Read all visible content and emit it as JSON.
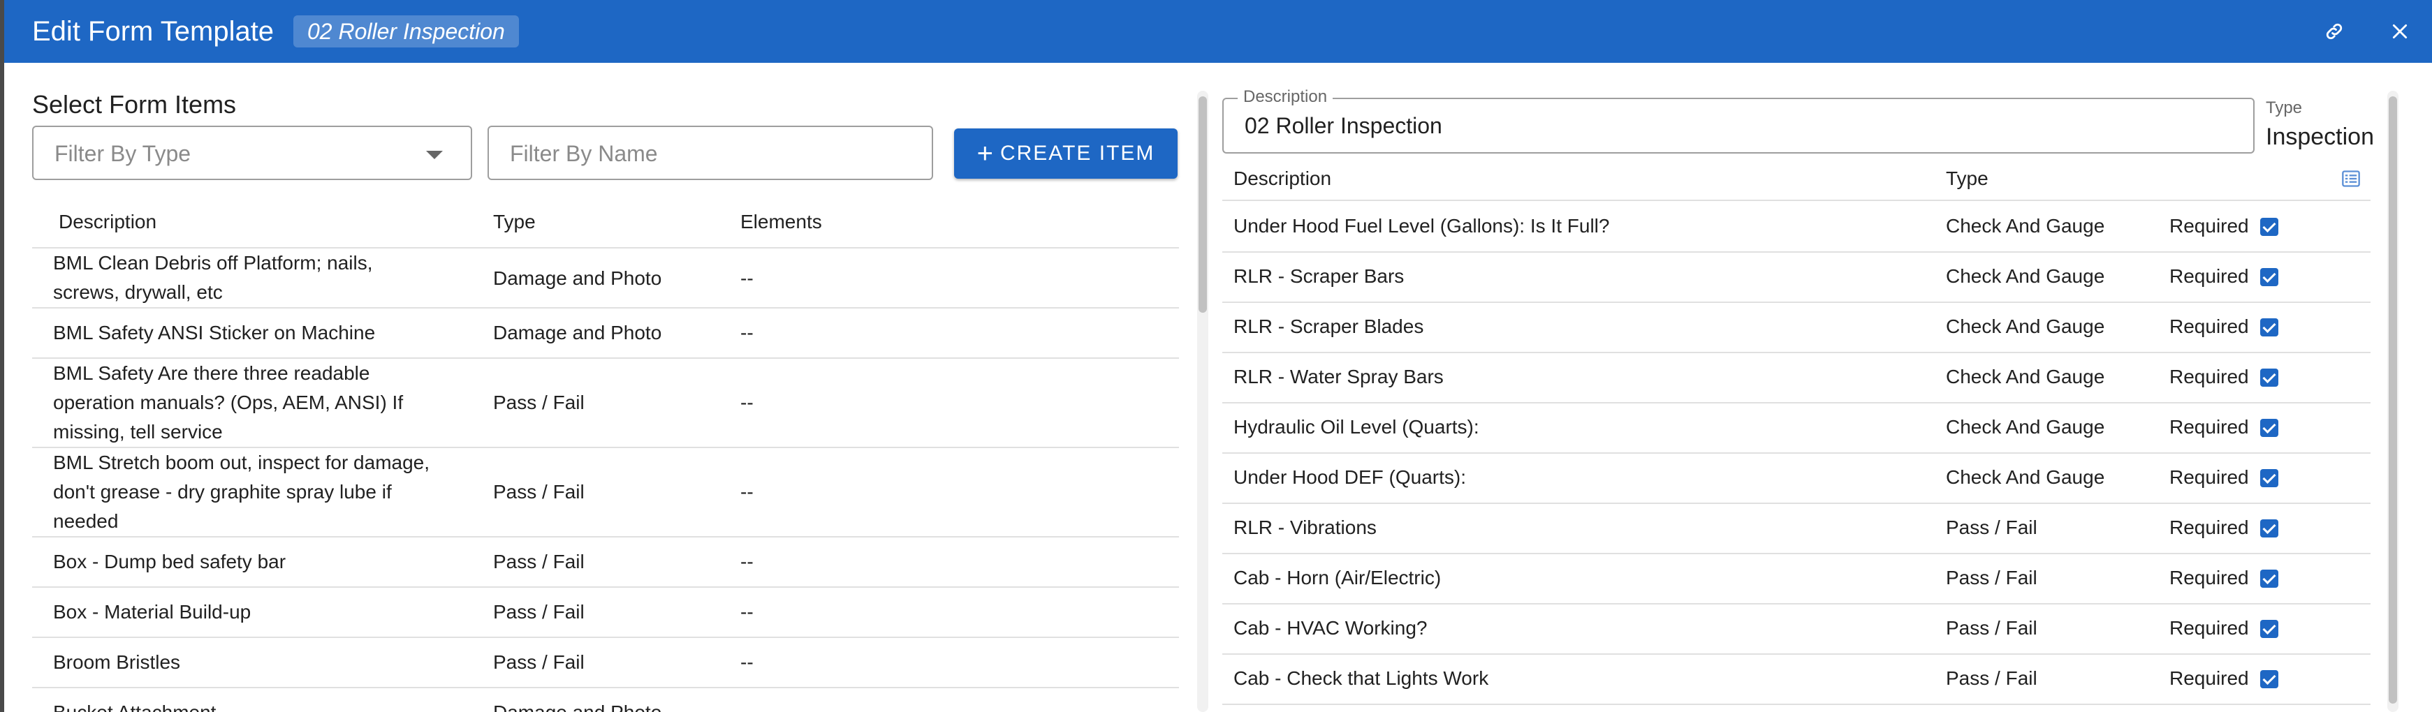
{
  "dialog": {
    "title": "Edit Form Template",
    "template_chip": "02 Roller Inspection"
  },
  "left": {
    "heading": "Select Form Items",
    "filter_type_placeholder": "Filter By Type",
    "filter_name_placeholder": "Filter By Name",
    "create_label": "CREATE ITEM",
    "columns": [
      "Description",
      "Type",
      "Elements"
    ],
    "rows": [
      {
        "description": "BML Clean Debris off Platform; nails, screws, drywall, etc",
        "type": "Damage and Photo",
        "elements": "--"
      },
      {
        "description": "BML Safety ANSI Sticker on Machine",
        "type": "Damage and Photo",
        "elements": "--"
      },
      {
        "description": "BML Safety Are there three readable operation manuals? (Ops, AEM, ANSI) If missing, tell service",
        "type": "Pass / Fail",
        "elements": "--"
      },
      {
        "description": "BML Stretch boom out, inspect for damage, don't grease - dry graphite spray lube if needed",
        "type": "Pass / Fail",
        "elements": "--"
      },
      {
        "description": "Box - Dump bed safety bar",
        "type": "Pass / Fail",
        "elements": "--"
      },
      {
        "description": "Box - Material Build-up",
        "type": "Pass / Fail",
        "elements": "--"
      },
      {
        "description": "Broom Bristles",
        "type": "Pass / Fail",
        "elements": "--"
      },
      {
        "description": "Bucket Attachment",
        "type": "Damage and Photo",
        "elements": ""
      }
    ]
  },
  "right": {
    "description_label": "Description",
    "description_value": "02 Roller Inspection",
    "type_label": "Type",
    "type_value": "Inspection",
    "columns": [
      "Description",
      "Type"
    ],
    "required_label": "Required",
    "rows": [
      {
        "description": "Under Hood Fuel Level (Gallons): Is It Full?",
        "type": "Check And Gauge"
      },
      {
        "description": "RLR - Scraper Bars",
        "type": "Check And Gauge"
      },
      {
        "description": "RLR - Scraper Blades",
        "type": "Check And Gauge"
      },
      {
        "description": "RLR - Water Spray Bars",
        "type": "Check And Gauge"
      },
      {
        "description": "Hydraulic Oil Level (Quarts):",
        "type": "Check And Gauge"
      },
      {
        "description": "Under Hood DEF (Quarts):",
        "type": "Check And Gauge"
      },
      {
        "description": "RLR - Vibrations",
        "type": "Pass / Fail"
      },
      {
        "description": "Cab - Horn (Air/Electric)",
        "type": "Pass / Fail"
      },
      {
        "description": "Cab - HVAC Working?",
        "type": "Pass / Fail"
      },
      {
        "description": "Cab - Check that Lights Work",
        "type": "Pass / Fail"
      }
    ]
  },
  "icons": {
    "link": "link-icon",
    "close": "close-icon",
    "dropdown": "chevron-down-icon",
    "list": "list-view-icon",
    "checkbox": "checkbox-checked-icon"
  },
  "colors": {
    "primary": "#1e67c4"
  }
}
